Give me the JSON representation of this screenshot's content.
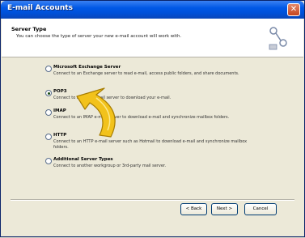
{
  "window": {
    "title": "E-mail Accounts",
    "close_glyph": "✕"
  },
  "header": {
    "title": "Server Type",
    "subtitle": "You can choose the type of server your new e-mail account will work with.",
    "icon": "server-connection-icon"
  },
  "options": [
    {
      "label": "Microsoft Exchange Server",
      "description": "Connect to an Exchange server to read e-mail, access public folders, and share documents.",
      "selected": false
    },
    {
      "label": "POP3",
      "description": "Connect to a POP3 e-mail server to download your e-mail.",
      "selected": true
    },
    {
      "label": "IMAP",
      "description": "Connect to an IMAP e-mail server to download e-mail and synchronize mailbox folders.",
      "selected": false
    },
    {
      "label": "HTTP",
      "description": "Connect to an HTTP e-mail server such as Hotmail to download e-mail and synchronize mailbox folders.",
      "selected": false
    },
    {
      "label": "Additional Server Types",
      "description": "Connect to another workgroup or 3rd-party mail server.",
      "selected": false
    }
  ],
  "buttons": {
    "back": "< Back",
    "next": "Next >",
    "cancel": "Cancel"
  },
  "annotation": {
    "icon": "pointer-arrow-icon",
    "color": "#f2c21b"
  }
}
